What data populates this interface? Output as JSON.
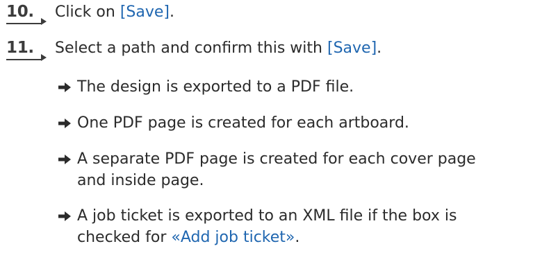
{
  "steps": [
    {
      "number": "10.",
      "pre": "Click on ",
      "ui": "[Save]",
      "post": "."
    },
    {
      "number": "11.",
      "pre": "Select a path and confirm this with ",
      "ui": "[Save]",
      "post": "."
    }
  ],
  "results": [
    {
      "text": "The design is exported to a PDF file."
    },
    {
      "text": "One PDF page is created for each artboard."
    },
    {
      "line1": "A separate PDF page is created for each cover page",
      "line2": "and inside page."
    },
    {
      "line1": "A job ticket is exported to an XML file if the box is",
      "line2_pre": "checked for ",
      "line2_accent": "«Add job ticket»",
      "line2_post": "."
    }
  ]
}
